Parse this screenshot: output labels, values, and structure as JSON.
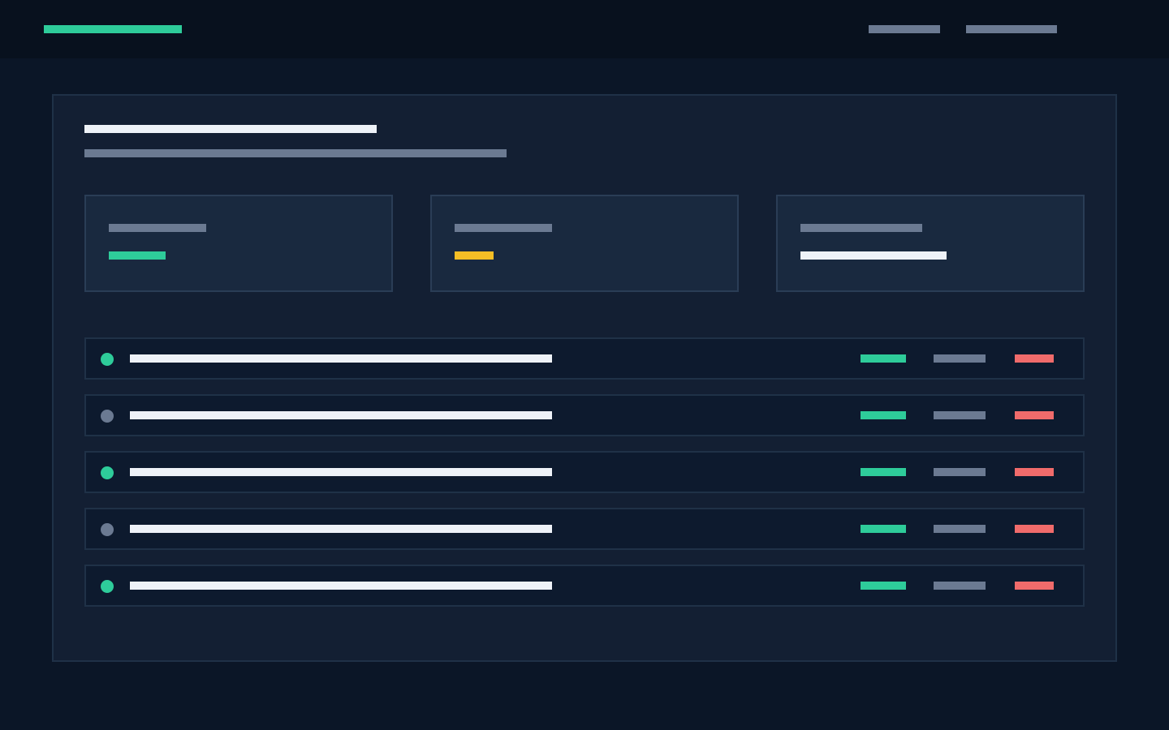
{
  "colors": {
    "page_background": "#0b1627",
    "topbar_background": "#08111e",
    "panel_background": "#131f33",
    "card_background": "#19293f",
    "row_background": "#0d1a2e",
    "accent_green": "#2ecc9a",
    "accent_yellow": "#f5be25",
    "accent_red": "#f06b6b",
    "muted_gray": "#6b7a92",
    "text_white": "#eef2f8"
  },
  "header": {
    "logo_color": "accent_green",
    "nav": [
      {
        "name": "nav-link-1",
        "color": "muted_gray"
      },
      {
        "name": "nav-link-2",
        "color": "muted_gray"
      }
    ]
  },
  "stats": [
    {
      "label_color": "muted_gray",
      "value_color": "accent_green"
    },
    {
      "label_color": "muted_gray",
      "value_color": "accent_yellow"
    },
    {
      "label_color": "muted_gray",
      "value_color": "text_white"
    }
  ],
  "rows": [
    {
      "status": "active"
    },
    {
      "status": "inactive"
    },
    {
      "status": "active"
    },
    {
      "status": "inactive"
    },
    {
      "status": "active"
    }
  ],
  "status_colors": {
    "active": "#2ecc9a",
    "inactive": "#6b7a92"
  },
  "row_tags": {
    "first": "accent_green",
    "second": "muted_gray",
    "third": "accent_red"
  }
}
